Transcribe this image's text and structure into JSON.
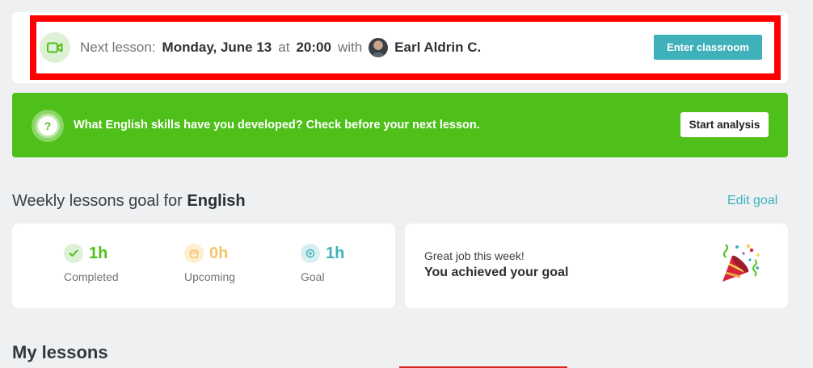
{
  "next_lesson": {
    "prefix": "Next lesson:",
    "date": "Monday, June 13",
    "at": "at",
    "time": "20:00",
    "with": "with",
    "tutor": "Earl Aldrin C.",
    "button": "Enter classroom",
    "icon": "video-camera-icon"
  },
  "banner": {
    "icon": "question",
    "text": "What English skills have you developed? Check before your next lesson.",
    "button": "Start analysis"
  },
  "weekly_goal": {
    "title_prefix": "Weekly lessons goal for",
    "language": "English",
    "edit_link": "Edit goal",
    "stats": [
      {
        "value": "1h",
        "label": "Completed",
        "color": "#4fc01a",
        "icon": "check-icon"
      },
      {
        "value": "0h",
        "label": "Upcoming",
        "color": "#f3c56a",
        "icon": "calendar-icon"
      },
      {
        "value": "1h",
        "label": "Goal",
        "color": "#3eb1bb",
        "icon": "target-icon"
      }
    ],
    "achievement": {
      "subtitle": "Great job this week!",
      "title": "You achieved your goal",
      "icon": "party-popper-icon"
    }
  },
  "my_lessons": {
    "title": "My lessons"
  },
  "colors": {
    "accent": "#3eb1bb",
    "green": "#4fc01a",
    "highlight": "#ff0000"
  }
}
